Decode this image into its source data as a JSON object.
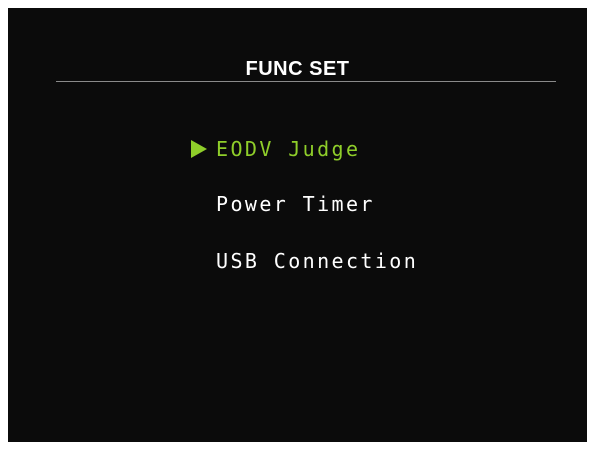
{
  "screen": {
    "title": "FUNC SET",
    "background": "#0b0b0b",
    "accent_color": "#8fce2a"
  },
  "menu": {
    "selected_index": 0,
    "cursor_icon": "play-triangle-icon",
    "items": [
      {
        "label": "EODV Judge",
        "selected": true
      },
      {
        "label": "Power Timer",
        "selected": false
      },
      {
        "label": "USB Connection",
        "selected": false
      }
    ]
  }
}
